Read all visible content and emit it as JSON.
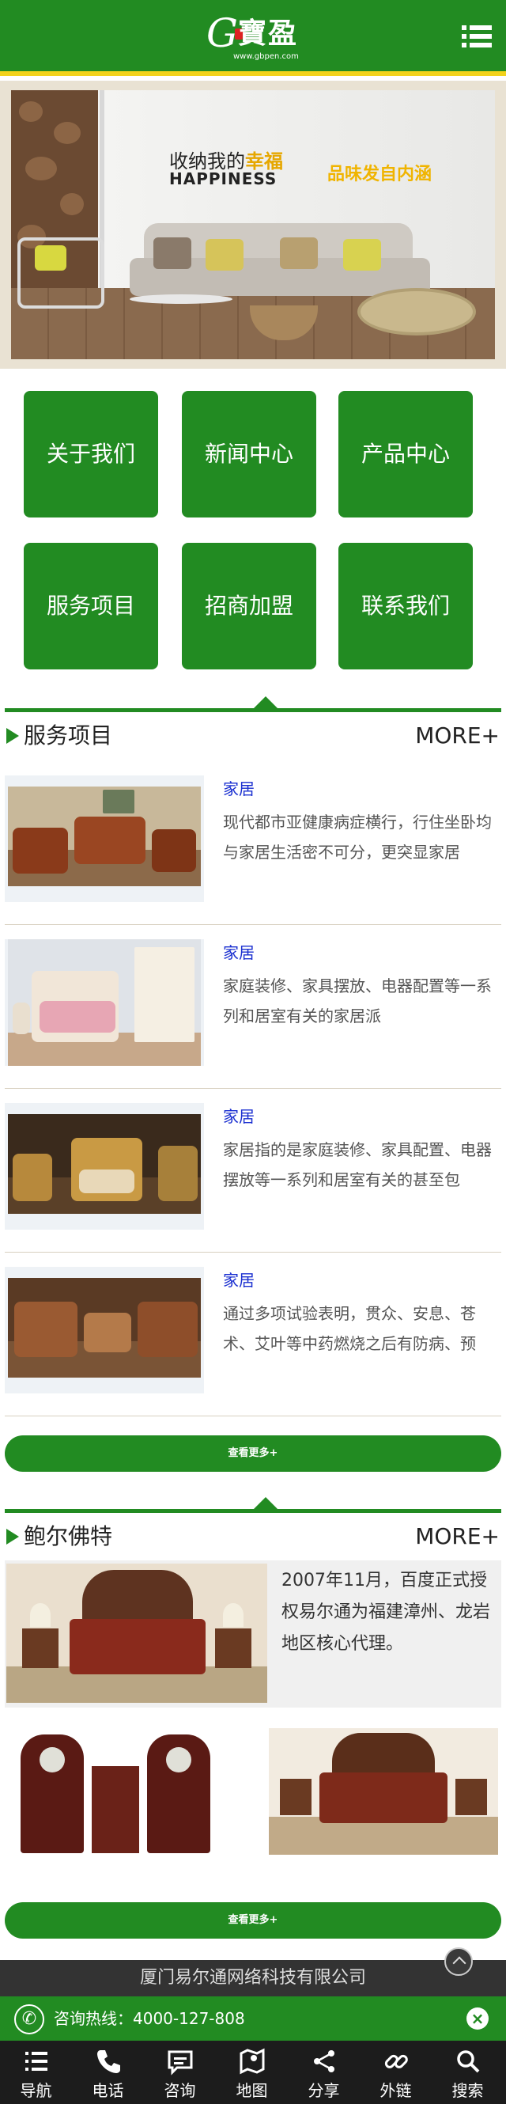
{
  "header": {
    "logo_letter": "G",
    "logo_text": "寶盈",
    "logo_url": "www.gbpen.com",
    "menu_icon": "hamburger-icon"
  },
  "banner": {
    "line1_prefix": "收纳我的",
    "line1_highlight": "幸福",
    "line2": "HAPPINESS",
    "slogan": "品味发自内涵"
  },
  "nav_tiles": [
    "关于我们",
    "新闻中心",
    "产品中心",
    "服务项目",
    "招商加盟",
    "联系我们"
  ],
  "services": {
    "title": "服务项目",
    "more": "MORE+",
    "items": [
      {
        "title": "家居",
        "desc": "现代都市亚健康病症横行，行住坐卧均与家居生活密不可分，更突显家居"
      },
      {
        "title": "家居",
        "desc": "家庭装修、家具摆放、电器配置等一系列和居室有关的家居派"
      },
      {
        "title": "家居",
        "desc": "家居指的是家庭装修、家具配置、电器摆放等一系列和居室有关的甚至包"
      },
      {
        "title": "家居",
        "desc": "通过多项试验表明，贯众、安息、苍术、艾叶等中药燃烧之后有防病、预"
      }
    ],
    "load_more": "查看更多+"
  },
  "brand": {
    "title": "鲍尔佛特",
    "more": "MORE+",
    "text": "2007年11月，百度正式授权易尔通为福建漳州、龙岩地区核心代理。",
    "load_more": "查看更多+"
  },
  "footer": {
    "company": "厦门易尔通网络科技有限公司",
    "hotline_label": "咨询热线：4000-127-808",
    "close": "×",
    "nav": [
      {
        "label": "导航",
        "icon": "list-icon"
      },
      {
        "label": "电话",
        "icon": "phone-icon"
      },
      {
        "label": "咨询",
        "icon": "chat-icon"
      },
      {
        "label": "地图",
        "icon": "map-icon"
      },
      {
        "label": "分享",
        "icon": "share-icon"
      },
      {
        "label": "外链",
        "icon": "link-icon"
      },
      {
        "label": "搜索",
        "icon": "search-icon"
      }
    ]
  },
  "colors": {
    "brand_green": "#228b22",
    "accent_yellow": "#f2d21b",
    "item_title_blue": "#1a2fd0",
    "footer_dark": "#1c1c1c"
  }
}
